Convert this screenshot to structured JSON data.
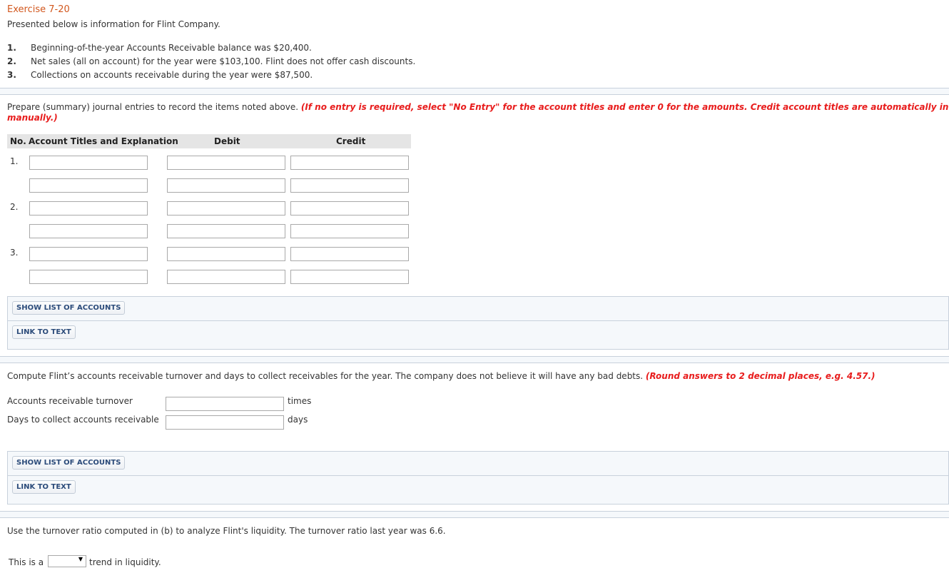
{
  "exercise": {
    "title": "Exercise 7-20",
    "intro": "Presented below is information for Flint Company.",
    "items": [
      {
        "num": "1.",
        "text": "Beginning-of-the-year Accounts Receivable balance was $20,400."
      },
      {
        "num": "2.",
        "text": "Net sales (all on account) for the year were $103,100. Flint does not offer cash discounts."
      },
      {
        "num": "3.",
        "text": "Collections on accounts receivable during the year were $87,500."
      }
    ]
  },
  "part_a": {
    "instruction": "Prepare (summary) journal entries to record the items noted above. ",
    "instruction_note_line1": "(If no entry is required, select \"No Entry\" for the account titles and enter 0 for the amounts. Credit account titles are automatically in",
    "instruction_note_line2": "manually.)",
    "table": {
      "headers": {
        "no": "No.",
        "account": "Account Titles and Explanation",
        "debit": "Debit",
        "credit": "Credit"
      },
      "rows": [
        {
          "num": "1.",
          "account": "",
          "debit": "",
          "credit": ""
        },
        {
          "num": "",
          "account": "",
          "debit": "",
          "credit": ""
        },
        {
          "num": "2.",
          "account": "",
          "debit": "",
          "credit": ""
        },
        {
          "num": "",
          "account": "",
          "debit": "",
          "credit": ""
        },
        {
          "num": "3.",
          "account": "",
          "debit": "",
          "credit": ""
        },
        {
          "num": "",
          "account": "",
          "debit": "",
          "credit": ""
        }
      ]
    },
    "show_accounts_label": "SHOW LIST OF ACCOUNTS",
    "link_text_label": "LINK TO TEXT"
  },
  "part_b": {
    "instruction": "Compute Flint’s accounts receivable turnover and days to collect receivables for the year. The company does not believe it will have any bad debts. ",
    "instruction_note": "(Round answers to 2 decimal places, e.g. 4.57.)",
    "fields": [
      {
        "label": "Accounts receivable turnover",
        "value": "",
        "unit": "times"
      },
      {
        "label": "Days to collect accounts receivable",
        "value": "",
        "unit": "days"
      }
    ],
    "show_accounts_label": "SHOW LIST OF ACCOUNTS",
    "link_text_label": "LINK TO TEXT"
  },
  "part_c": {
    "instruction": "Use the turnover ratio computed in (b) to analyze Flint's liquidity. The turnover ratio last year was 6.6.",
    "prefix": "This is a",
    "select_value": "",
    "suffix": "trend in liquidity."
  }
}
